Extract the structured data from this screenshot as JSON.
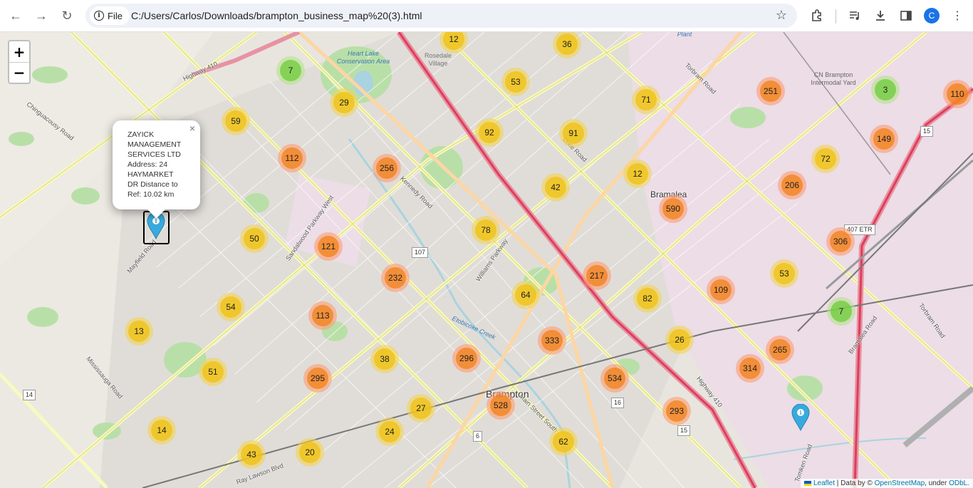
{
  "browser": {
    "site_chip": "File",
    "url": "C:/Users/Carlos/Downloads/brampton_business_map%20(3).html",
    "profile_initial": "C"
  },
  "map": {
    "zoom_in": "+",
    "zoom_out": "−",
    "popup": {
      "close": "×",
      "lines": [
        "ZAYICK",
        "MANAGEMENT",
        "SERVICES LTD",
        "Address: 24",
        "HAYMARKET",
        "DR Distance to",
        "Ref: 10.02 km"
      ]
    },
    "places": [
      "Brampton",
      "Bramalea"
    ],
    "water_labels": [
      "Heart Lake Conservation Area",
      "Rosedale Village",
      "Etobicoke Creek",
      "CN Brampton Intermodal Yard",
      "Plant"
    ],
    "road_labels": [
      "Highway 410",
      "Chinguacousy Road",
      "Kennedy Road",
      "Dixie Road",
      "Torbram Road",
      "Sandalwood Parkway West",
      "Mayfield Road",
      "Williams Parkway",
      "Mississauga Road",
      "Main Street South",
      "Bramalea Road",
      "Tomken Road",
      "Torbram Road",
      "Highway 410",
      "Ray Lawson Blvd"
    ],
    "shields": [
      "107",
      "407 ETR",
      "14",
      "15",
      "16",
      "6",
      "15"
    ],
    "clusters": [
      {
        "n": "12",
        "level": "med"
      },
      {
        "n": "36",
        "level": "med"
      },
      {
        "n": "7",
        "level": "small"
      },
      {
        "n": "53",
        "level": "med"
      },
      {
        "n": "29",
        "level": "med"
      },
      {
        "n": "71",
        "level": "med"
      },
      {
        "n": "251",
        "level": "large"
      },
      {
        "n": "3",
        "level": "small"
      },
      {
        "n": "110",
        "level": "large"
      },
      {
        "n": "59",
        "level": "med"
      },
      {
        "n": "92",
        "level": "med"
      },
      {
        "n": "91",
        "level": "med"
      },
      {
        "n": "149",
        "level": "large"
      },
      {
        "n": "112",
        "level": "large"
      },
      {
        "n": "256",
        "level": "large"
      },
      {
        "n": "72",
        "level": "med"
      },
      {
        "n": "12",
        "level": "med"
      },
      {
        "n": "42",
        "level": "med"
      },
      {
        "n": "206",
        "level": "large"
      },
      {
        "n": "590",
        "level": "large"
      },
      {
        "n": "50",
        "level": "med"
      },
      {
        "n": "78",
        "level": "med"
      },
      {
        "n": "121",
        "level": "large"
      },
      {
        "n": "306",
        "level": "large"
      },
      {
        "n": "232",
        "level": "large"
      },
      {
        "n": "217",
        "level": "large"
      },
      {
        "n": "53",
        "level": "med"
      },
      {
        "n": "64",
        "level": "med"
      },
      {
        "n": "82",
        "level": "med"
      },
      {
        "n": "109",
        "level": "large"
      },
      {
        "n": "54",
        "level": "med"
      },
      {
        "n": "113",
        "level": "large"
      },
      {
        "n": "7",
        "level": "small"
      },
      {
        "n": "13",
        "level": "med"
      },
      {
        "n": "333",
        "level": "large"
      },
      {
        "n": "26",
        "level": "med"
      },
      {
        "n": "38",
        "level": "med"
      },
      {
        "n": "296",
        "level": "large"
      },
      {
        "n": "265",
        "level": "large"
      },
      {
        "n": "51",
        "level": "med"
      },
      {
        "n": "295",
        "level": "large"
      },
      {
        "n": "534",
        "level": "large"
      },
      {
        "n": "314",
        "level": "large"
      },
      {
        "n": "528",
        "level": "large"
      },
      {
        "n": "27",
        "level": "med"
      },
      {
        "n": "293",
        "level": "large"
      },
      {
        "n": "14",
        "level": "med"
      },
      {
        "n": "24",
        "level": "med"
      },
      {
        "n": "62",
        "level": "med"
      },
      {
        "n": "43",
        "level": "med"
      },
      {
        "n": "20",
        "level": "med"
      }
    ],
    "attribution": {
      "leaflet": "Leaflet",
      "sep": " | Data by © ",
      "osm": "OpenStreetMap",
      "under": ", under ",
      "odbl": "ODbL."
    }
  }
}
